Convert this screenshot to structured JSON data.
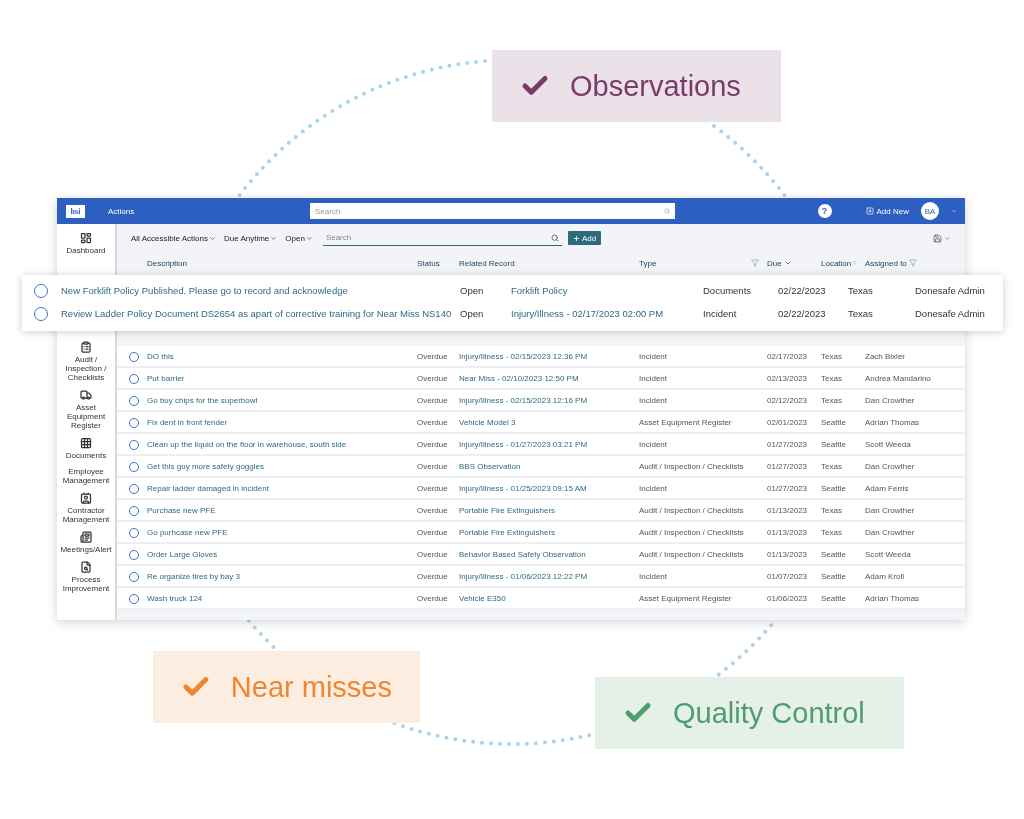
{
  "badges": [
    {
      "label": "Observations",
      "color": "#7b3b6a"
    },
    {
      "label": "Near misses",
      "color": "#ee8733"
    },
    {
      "label": "Quality Control",
      "color": "#4f9c6e"
    }
  ],
  "app": {
    "logo": "hsi",
    "title": "Actions",
    "search_placeholder": "Search",
    "help": "?",
    "add_new": "Add New",
    "avatar": "BA",
    "sidebar": [
      {
        "label": "Dashboard"
      },
      {
        "label": "Audit / Inspection / Checklists"
      },
      {
        "label": "Asset Equipment Register"
      },
      {
        "label": "Documents"
      },
      {
        "label": "Employee Management"
      },
      {
        "label": "Contractor Management"
      },
      {
        "label": "Meetings/Alert"
      },
      {
        "label": "Process Improvement"
      }
    ],
    "filters": [
      "All Accessible Actions",
      "Due Anytime",
      "Open"
    ],
    "list_search_placeholder": "Search",
    "add_button": "Add",
    "columns": [
      {
        "label": "Description",
        "filterable": false,
        "sorted": false
      },
      {
        "label": "Status",
        "filterable": false,
        "sorted": false
      },
      {
        "label": "Related Record",
        "filterable": false,
        "sorted": false
      },
      {
        "label": "Type",
        "filterable": true,
        "sorted": false
      },
      {
        "label": "Due",
        "filterable": false,
        "sorted": true
      },
      {
        "label": "Location",
        "filterable": true,
        "sorted": false
      },
      {
        "label": "Assigned to",
        "filterable": true,
        "sorted": false
      }
    ],
    "rows": [
      {
        "description": "DO this",
        "status": "Overdue",
        "related": "Injury/Illness - 02/15/2023 12:36 PM",
        "type": "Incident",
        "due": "02/17/2023",
        "location": "Texas",
        "assigned": "Zach Bixler"
      },
      {
        "description": "Put barrier",
        "status": "Overdue",
        "related": "Near Miss - 02/10/2023 12:50 PM",
        "type": "Incident",
        "due": "02/13/2023",
        "location": "Texas",
        "assigned": "Andrea Mandarino"
      },
      {
        "description": "Go buy chips for the superbowl",
        "status": "Overdue",
        "related": "Injury/Illness - 02/15/2023 12:16 PM",
        "type": "Incident",
        "due": "02/12/2023",
        "location": "Texas",
        "assigned": "Dan Crowther"
      },
      {
        "description": "Fix dent in front fender",
        "status": "Overdue",
        "related": "Vehicle Model 3",
        "type": "Asset Equipment Register",
        "due": "02/01/2023",
        "location": "Seattle",
        "assigned": "Adrian Thomas"
      },
      {
        "description": "Clean up the liquid on the floor in warehouse, south side",
        "status": "Overdue",
        "related": "Injury/Illness - 01/27/2023 03:21 PM",
        "type": "Incident",
        "due": "01/27/2023",
        "location": "Seattle",
        "assigned": "Scott Weeda"
      },
      {
        "description": "Get this guy more safety goggles",
        "status": "Overdue",
        "related": "BBS Observation",
        "type": "Audit / Inspection / Checklists",
        "due": "01/27/2023",
        "location": "Texas",
        "assigned": "Dan Crowther"
      },
      {
        "description": "Repair ladder damaged in incident",
        "status": "Overdue",
        "related": "Injury/Illness - 01/25/2023 09:15 AM",
        "type": "Incident",
        "due": "01/27/2023",
        "location": "Seattle",
        "assigned": "Adam Ferris"
      },
      {
        "description": "Purchase new PFE",
        "status": "Overdue",
        "related": "Portable Fire Extinguishers",
        "type": "Audit / Inspection / Checklists",
        "due": "01/13/2023",
        "location": "Texas",
        "assigned": "Dan Crowther"
      },
      {
        "description": "Go purhcase new PFE",
        "status": "Overdue",
        "related": "Portable Fire Extinguishers",
        "type": "Audit / Inspection / Checklists",
        "due": "01/13/2023",
        "location": "Texas",
        "assigned": "Dan Crowther"
      },
      {
        "description": "Order Large Gloves",
        "status": "Overdue",
        "related": "Behavior Based Safety Observation",
        "type": "Audit / Inspection / Checklists",
        "due": "01/13/2023",
        "location": "Seattle",
        "assigned": "Scott Weeda"
      },
      {
        "description": "Re organize tires by bay 3",
        "status": "Overdue",
        "related": "Injury/Illness - 01/06/2023 12:22 PM",
        "type": "Incident",
        "due": "01/07/2023",
        "location": "Seattle",
        "assigned": "Adam Kroll"
      },
      {
        "description": "Wash truck 124",
        "status": "Overdue",
        "related": "Vehicle E350",
        "type": "Asset Equipment Register",
        "due": "01/06/2023",
        "location": "Seattle",
        "assigned": "Adrian Thomas"
      }
    ]
  },
  "highlighted_rows": [
    {
      "description": "New Forklift Policy Published. Please go to record and acknowledge",
      "status": "Open",
      "related": "Forklift Policy",
      "type": "Documents",
      "due": "02/22/2023",
      "location": "Texas",
      "assigned": "Donesafe Admin"
    },
    {
      "description": "Review Ladder Policy Document DS2654 as apart of corrective training for Near Miss NS140",
      "status": "Open",
      "related": "Injury/Illness - 02/17/2023 02:00 PM",
      "type": "Incident",
      "due": "02/22/2023",
      "location": "Texas",
      "assigned": "Donesafe Admin"
    }
  ]
}
